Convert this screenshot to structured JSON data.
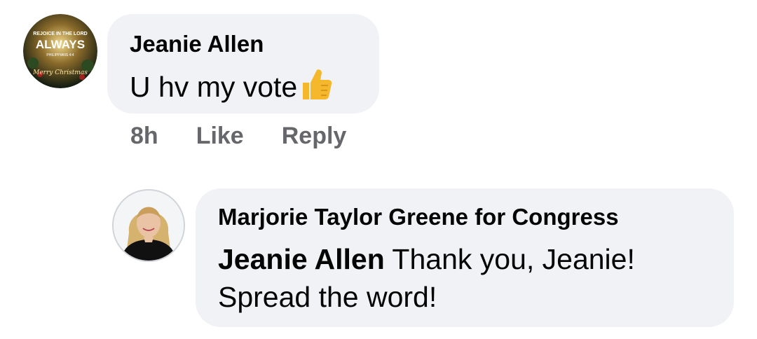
{
  "comment": {
    "author": "Jeanie Allen",
    "text": "U hv my vote",
    "emoji": "thumbs-up-icon",
    "avatar_text_line1": "REJOICE IN THE LORD",
    "avatar_text_line2": "ALWAYS",
    "avatar_text_line3": "PHILIPPIANS 4:4",
    "avatar_text_line4": "Merry Christmas",
    "time": "8h",
    "like_label": "Like",
    "reply_label": "Reply"
  },
  "reply": {
    "author": "Marjorie Taylor Greene for Congress",
    "mention": "Jeanie Allen",
    "text_line1": "Thank you, Jeanie!",
    "text_line2": "Spread the word!"
  },
  "colors": {
    "bubble": "#f0f2f5",
    "meta": "#65676b",
    "text": "#050505",
    "thumb": "#f5b72b"
  }
}
